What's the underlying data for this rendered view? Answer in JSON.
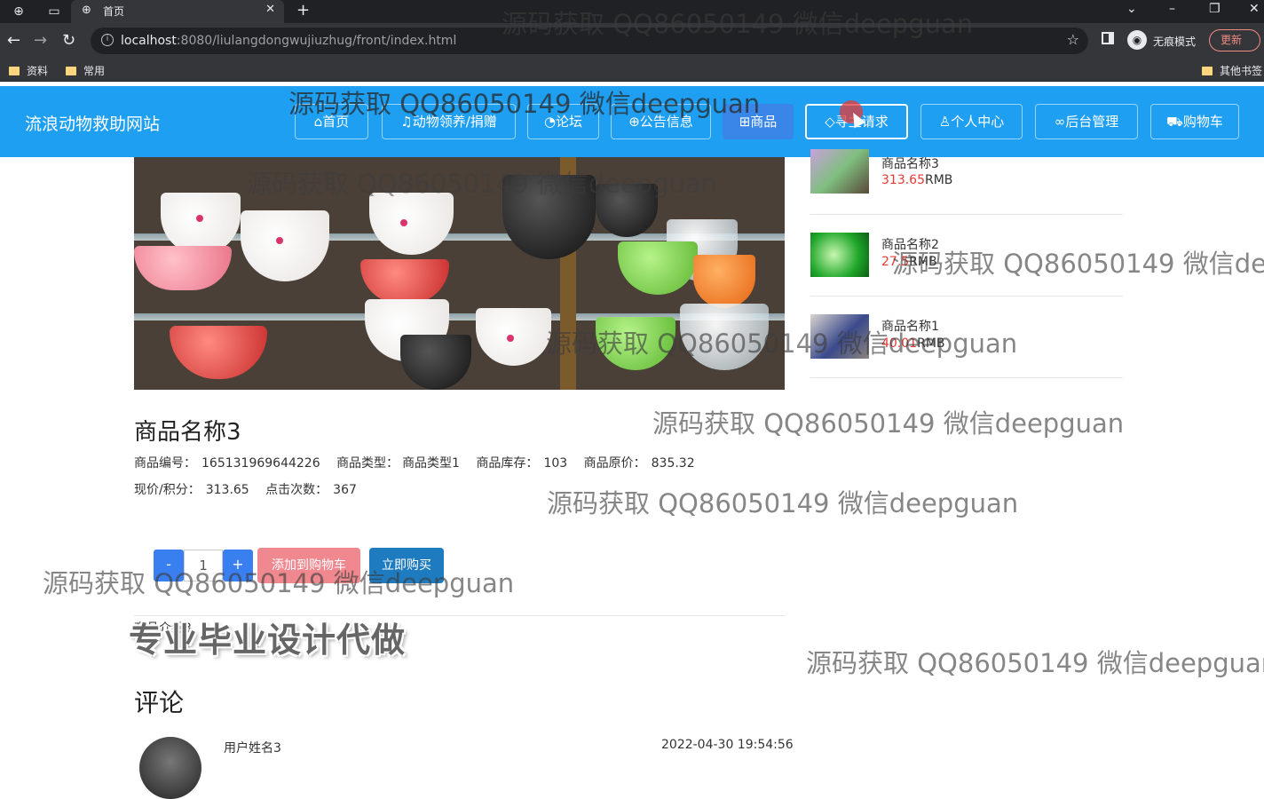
{
  "browser": {
    "tab_title": "首页",
    "url_host": "localhost",
    "url_path": ":8080/liulangdongwujiuzhug/front/index.html",
    "incognito_label": "无痕模式",
    "update_label": "更新",
    "bookmarks": [
      "资料",
      "常用"
    ],
    "other_bookmarks": "其他书签"
  },
  "site": {
    "title": "流浪动物救助网站",
    "nav": [
      {
        "icon": "home-icon",
        "label": "首页"
      },
      {
        "icon": "adopt-icon",
        "label": "动物领养/捐赠"
      },
      {
        "icon": "forum-icon",
        "label": "论坛"
      },
      {
        "icon": "globe-icon",
        "label": "公告信息"
      },
      {
        "icon": "book-icon",
        "label": "商品"
      },
      {
        "icon": "tag-icon",
        "label": "寻主请求"
      },
      {
        "icon": "user-icon",
        "label": "个人中心"
      },
      {
        "icon": "link-icon",
        "label": "后台管理"
      },
      {
        "icon": "cart-icon",
        "label": "购物车"
      }
    ],
    "active_nav": "商品",
    "accent_color": "#1e9ff2"
  },
  "recommended": [
    {
      "name": "商品名称3",
      "price": "313.65",
      "unit": "RMB"
    },
    {
      "name": "商品名称2",
      "price": "27.5",
      "unit": "RMB"
    },
    {
      "name": "商品名称1",
      "price": "40.01",
      "unit": "RMB"
    }
  ],
  "product": {
    "title": "商品名称3",
    "code_label": "商品编号：",
    "code": "165131969644226",
    "type_label": "商品类型：",
    "type": "商品类型1",
    "stock_label": "商品库存：",
    "stock": "103",
    "original_price_label": "商品原价：",
    "original_price": "835.32",
    "current_price_label": "现价/积分：",
    "current_price": "313.65",
    "clicks_label": "点击次数：",
    "clicks": "367",
    "quantity": "1",
    "minus_label": "-",
    "plus_label": "+",
    "add_to_cart_label": "添加到购物车",
    "buy_now_label": "立即购买",
    "intro": "商品介绍3"
  },
  "promo_overlay": "专业毕业设计代做",
  "comments": {
    "heading": "评论",
    "items": [
      {
        "user": "用户姓名3",
        "time": "2022-04-30 19:54:56"
      }
    ]
  },
  "watermark": "源码获取 QQ86050149 微信deepguan"
}
